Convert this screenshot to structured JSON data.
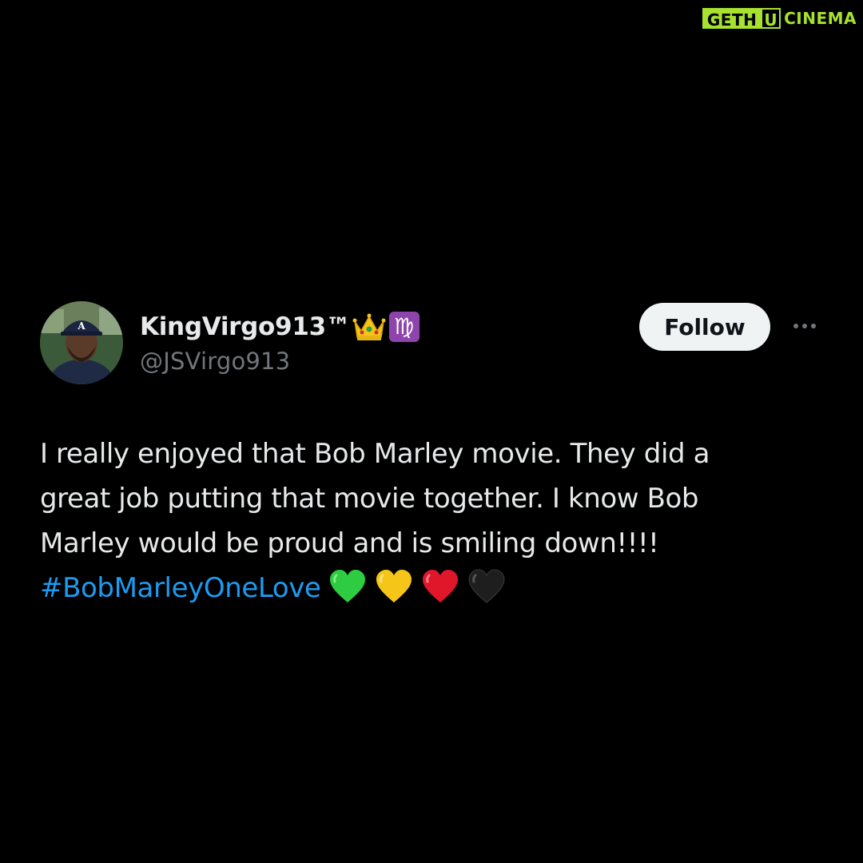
{
  "watermark": {
    "part1": "GETH",
    "part2": "U",
    "part3": "CINEMA"
  },
  "tweet": {
    "display_name": "KingVirgo913™",
    "badges": [
      "crown-icon",
      "virgo-icon"
    ],
    "virgo_glyph": "♍",
    "handle": "@JSVirgo913",
    "follow_label": "Follow",
    "text_lines": [
      "I really enjoyed that Bob Marley movie. They did a",
      "great job putting that movie together. I know Bob",
      "Marley would be proud and is smiling down!!!!"
    ],
    "hashtag": "#BobMarleyOneLove",
    "heart_emojis": [
      {
        "name": "green-heart-icon",
        "color": "#2ecc40"
      },
      {
        "name": "yellow-heart-icon",
        "color": "#f5c518"
      },
      {
        "name": "red-heart-icon",
        "color": "#e0162b"
      },
      {
        "name": "black-heart-icon",
        "color": "#1e1e1e"
      }
    ]
  },
  "colors": {
    "background": "#000000",
    "text_primary": "#e7e9ea",
    "text_secondary": "#71767b",
    "link": "#1d9bf0",
    "follow_bg": "#eff3f4",
    "watermark": "#a6e22e"
  }
}
